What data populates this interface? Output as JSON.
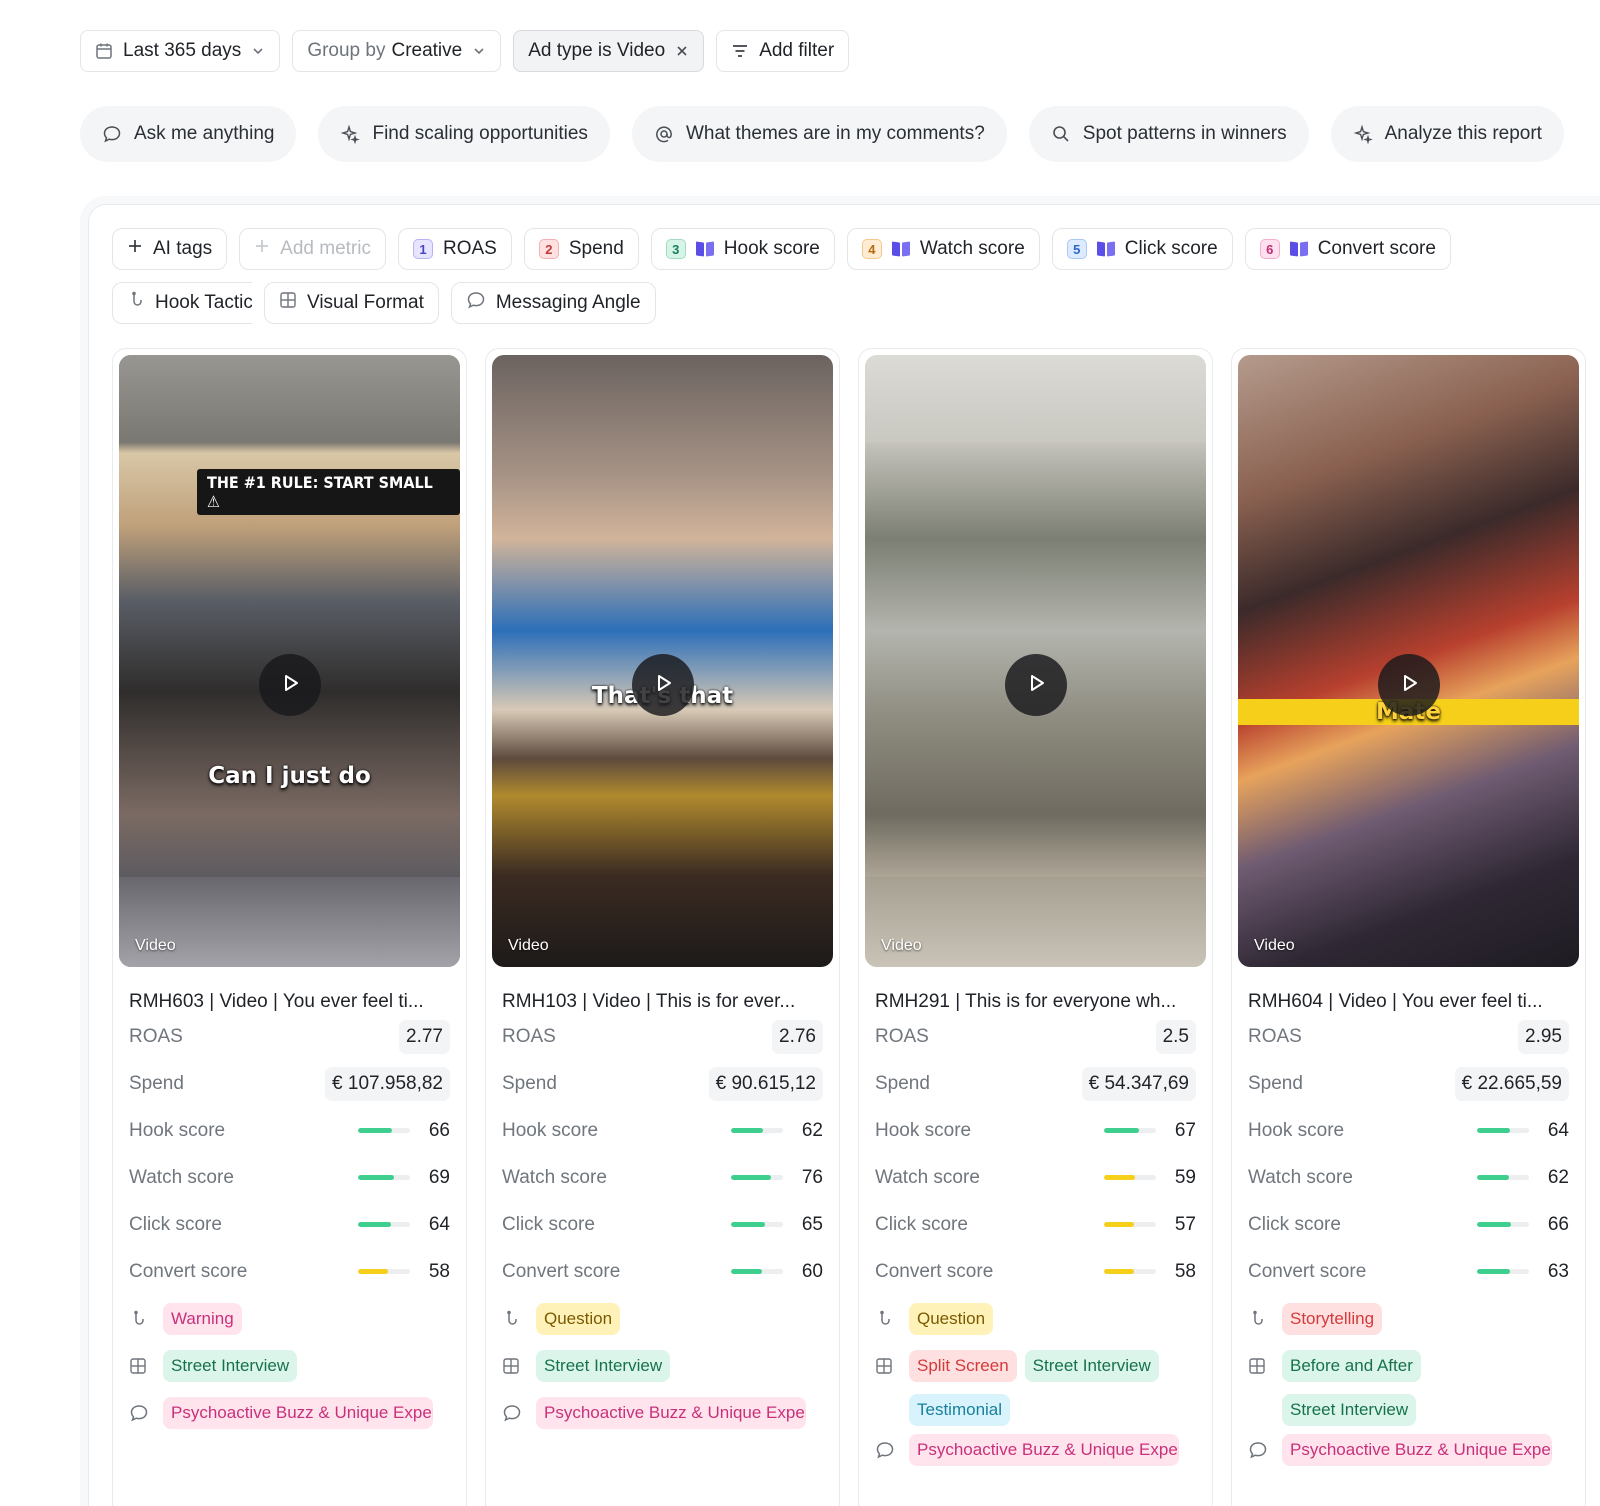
{
  "filters": {
    "date": "Last 365 days",
    "group_prefix": "Group by",
    "group_value": "Creative",
    "ad_type": "Ad type is Video",
    "add_filter": "Add filter"
  },
  "prompts": [
    "Ask me anything",
    "Find scaling opportunities",
    "What themes are in my comments?",
    "Spot patterns in winners",
    "Analyze this report"
  ],
  "metric_chips": {
    "ai_tags": "AI tags",
    "add_metric": "Add metric",
    "roas": "ROAS",
    "spend": "Spend",
    "hook": "Hook score",
    "watch": "Watch score",
    "click": "Click score",
    "convert": "Convert score",
    "hook_tactic": "Hook Tactic",
    "visual_format": "Visual Format",
    "messaging_angle": "Messaging Angle",
    "nums": [
      "1",
      "2",
      "3",
      "4",
      "5",
      "6"
    ]
  },
  "row_labels": {
    "roas": "ROAS",
    "spend": "Spend",
    "hook": "Hook score",
    "watch": "Watch score",
    "click": "Click score",
    "convert": "Convert score"
  },
  "colors": {
    "score_good": "#3ecf8e",
    "score_mid": "#f6cf1a"
  },
  "cards": [
    {
      "video_label": "Video",
      "caption": "Can I just do",
      "banner": "THE #1 RULE: START SMALL ⚠",
      "title": "RMH603 | Video | You ever feel ti...",
      "roas": "2.77",
      "spend": "€ 107.958,82",
      "hook": 66,
      "watch": 69,
      "click": 64,
      "convert": 58,
      "hook_tactic_tags": [
        "Warning"
      ],
      "visual_format_tags": [
        "Street Interview"
      ],
      "messaging_angle_tags": [
        "Psychoactive Buzz & Unique Experi"
      ]
    },
    {
      "video_label": "Video",
      "caption": "That's that",
      "banner": "",
      "title": "RMH103 | Video | This is for ever...",
      "roas": "2.76",
      "spend": "€ 90.615,12",
      "hook": 62,
      "watch": 76,
      "click": 65,
      "convert": 60,
      "hook_tactic_tags": [
        "Question"
      ],
      "visual_format_tags": [
        "Street Interview"
      ],
      "messaging_angle_tags": [
        "Psychoactive Buzz & Unique Experi"
      ]
    },
    {
      "video_label": "Video",
      "caption": "",
      "banner": "",
      "title": "RMH291 | This is for everyone wh...",
      "roas": "2.5",
      "spend": "€ 54.347,69",
      "hook": 67,
      "watch": 59,
      "click": 57,
      "convert": 58,
      "hook_tactic_tags": [
        "Question"
      ],
      "visual_format_tags": [
        "Split Screen",
        "Street Interview",
        "Testimonial"
      ],
      "messaging_angle_tags": [
        "Psychoactive Buzz & Unique Experi"
      ]
    },
    {
      "video_label": "Video",
      "caption": "Mate",
      "banner": "",
      "title": "RMH604 | Video | You ever feel ti...",
      "roas": "2.95",
      "spend": "€ 22.665,59",
      "hook": 64,
      "watch": 62,
      "click": 66,
      "convert": 63,
      "hook_tactic_tags": [
        "Storytelling"
      ],
      "visual_format_tags": [
        "Before and After",
        "Street Interview"
      ],
      "messaging_angle_tags": [
        "Psychoactive Buzz & Unique Experi"
      ]
    }
  ]
}
